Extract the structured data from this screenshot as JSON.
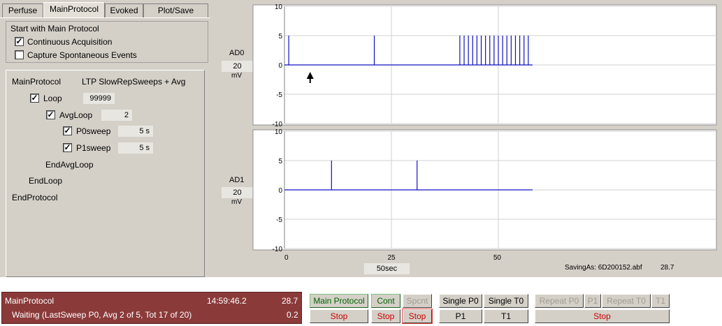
{
  "tabs": [
    "Perfuse",
    "MainProtocol",
    "Evoked",
    "Plot/Save"
  ],
  "start_group": {
    "title": "Start with Main Protocol",
    "continuous": {
      "label": "Continuous Acquisition",
      "checked": "✓"
    },
    "capture": {
      "label": "Capture Spontaneous Events",
      "checked": ""
    }
  },
  "protocol": {
    "name": "MainProtocol",
    "description": "LTP SlowRepSweeps + Avg",
    "loop": {
      "label": "Loop",
      "value": "99999",
      "checked": "✓"
    },
    "avgloop": {
      "label": "AvgLoop",
      "value": "2",
      "checked": "✓"
    },
    "p0sweep": {
      "label": "P0sweep",
      "value": "5 s",
      "checked": "✓"
    },
    "p1sweep": {
      "label": "P1sweep",
      "value": "5 s",
      "checked": "✓"
    },
    "end_avgloop": "EndAvgLoop",
    "end_loop": "EndLoop",
    "end_protocol": "EndProtocol"
  },
  "chart_data": [
    {
      "type": "line",
      "channel": "AD0",
      "scale": "20",
      "unit": "mV",
      "ylim": [
        -10,
        10
      ],
      "yticks": [
        "10",
        "5",
        "0",
        "-5",
        "-10"
      ],
      "spikes_x": [
        1,
        21,
        41,
        42,
        43,
        44,
        45,
        46,
        47,
        48,
        49,
        50,
        51,
        52,
        53,
        54,
        55,
        56,
        57
      ],
      "spike_height": 5,
      "trace_end_x": 58,
      "baseline": 0,
      "color": "#1010c0"
    },
    {
      "type": "line",
      "channel": "AD1",
      "scale": "20",
      "unit": "mV",
      "ylim": [
        -10,
        10
      ],
      "yticks": [
        "10",
        "5",
        "0",
        "-5",
        "-10"
      ],
      "spikes_x": [
        11,
        31
      ],
      "spike_height": 5,
      "trace_end_x": 58,
      "baseline": 0,
      "color": "#1010c0"
    }
  ],
  "x_axis": {
    "ticks": [
      "0",
      "25",
      "50"
    ],
    "range": [
      0,
      100
    ],
    "scale_label": "50sec"
  },
  "saving_label": "SavingAs: 6D200152.abf",
  "saving_value": "28.7",
  "status": {
    "protocol": "MainProtocol",
    "time": "14:59:46.2",
    "value1": "28.7",
    "message": "Waiting  (LastSweep P0, Avg 2 of 5, Tot 17 of 20)",
    "value2": "0.2"
  },
  "buttons": {
    "main_protocol": "Main Protocol",
    "cont": "Cont",
    "spcnt": "Spcnt",
    "stop1": "Stop",
    "stop2": "Stop",
    "stop3": "Stop",
    "single_p0": "Single P0",
    "single_t0": "Single T0",
    "p1": "P1",
    "t1": "T1",
    "repeat_p0": "Repeat P0",
    "p1_small": "P1",
    "repeat_t0": "Repeat T0",
    "t1_small": "T1",
    "stop_repeat": "Stop"
  },
  "colors": {
    "status_bg": "#8b3a3a",
    "trace": "#1010c0",
    "stop": "#cc0000",
    "active_green": "#006400"
  }
}
